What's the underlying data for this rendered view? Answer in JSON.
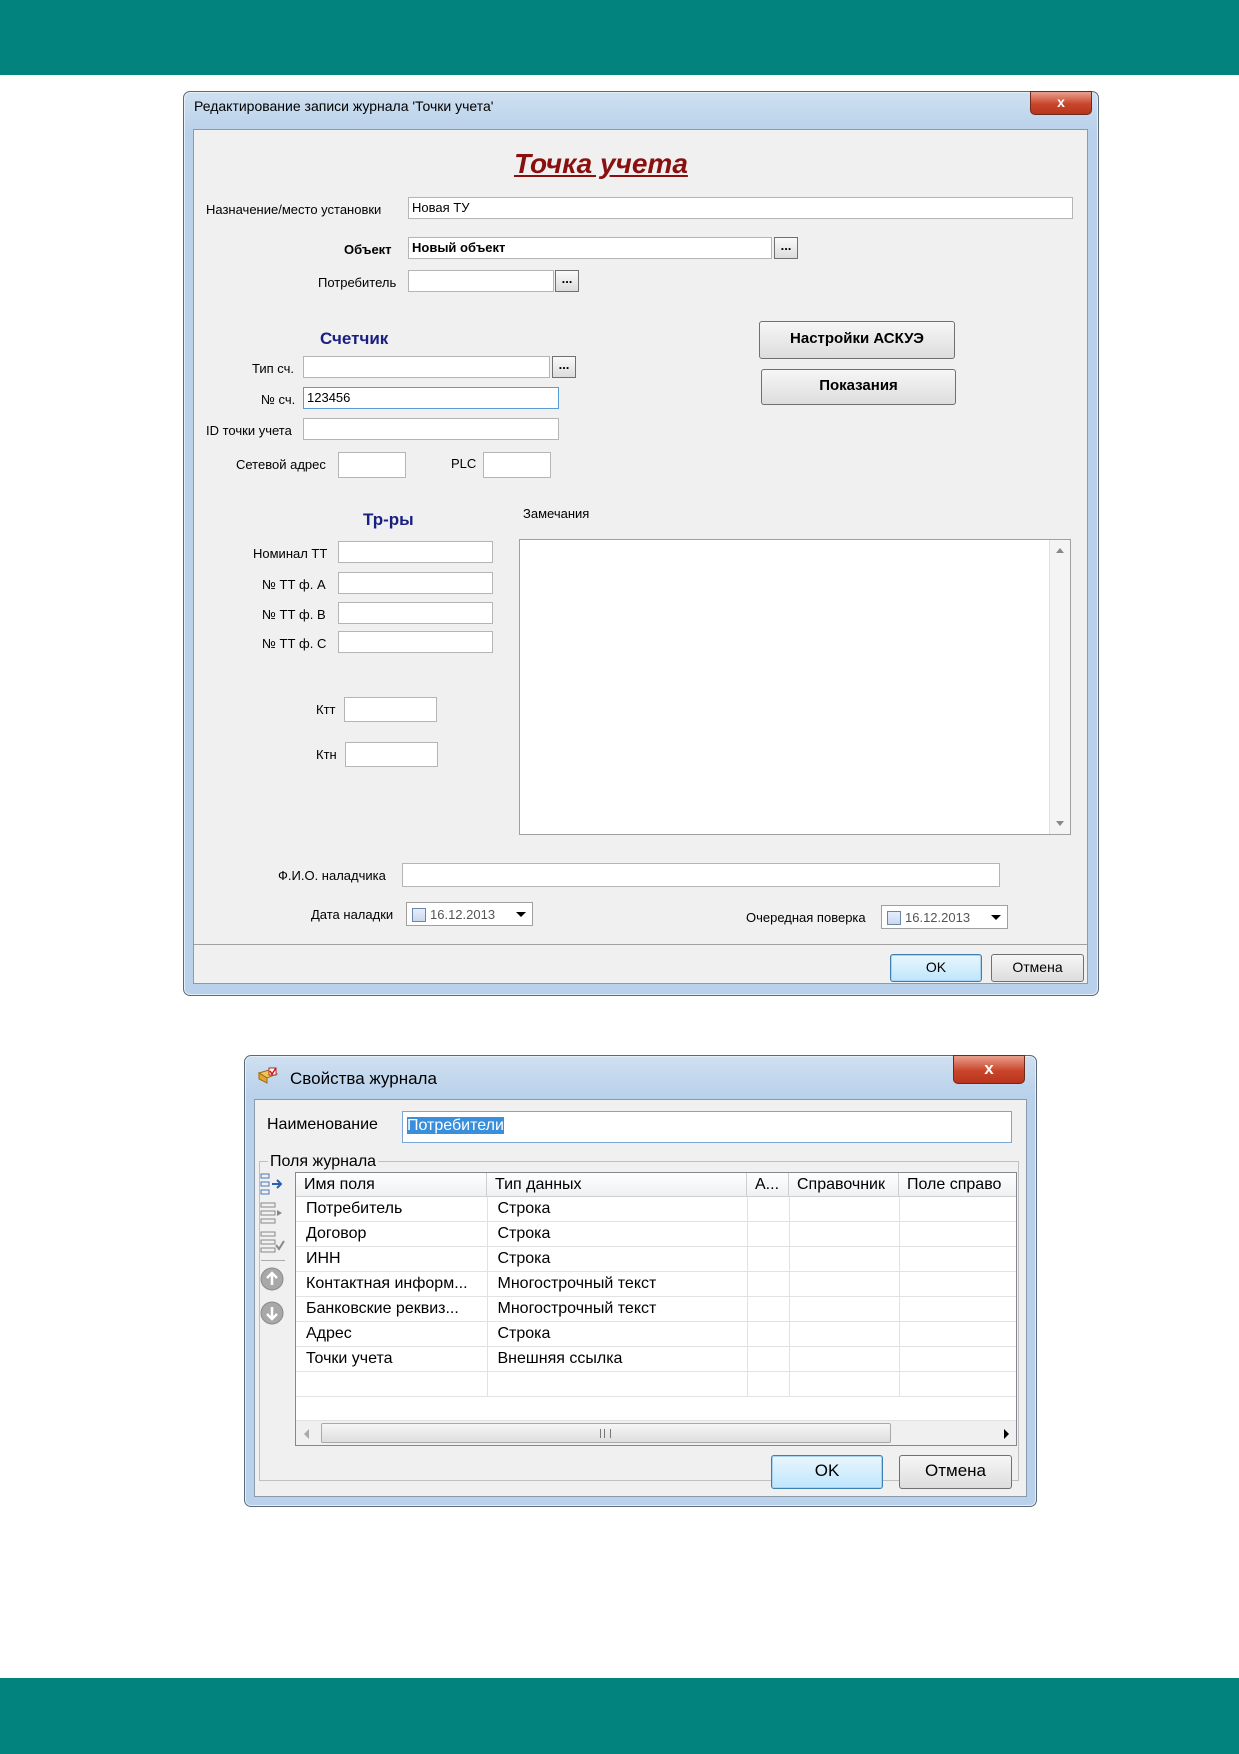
{
  "dialog1": {
    "title": "Редактирование записи журнала 'Точки учета'",
    "close": "x",
    "heading": "Точка учета",
    "purpose_label": "Назначение/место установки",
    "purpose_value": "Новая ТУ",
    "object_label": "Объект",
    "object_value": "Новый объект",
    "consumer_label": "Потребитель",
    "consumer_value": "",
    "meter_section": "Счетчик",
    "meter_type_label": "Тип сч.",
    "meter_type_value": "",
    "meter_no_label": "№ сч.",
    "meter_no_value": "123456",
    "point_id_label": "ID точки учета",
    "point_id_value": "",
    "net_addr_label": "Сетевой адрес",
    "net_addr_value": "",
    "plc_label": "PLC",
    "plc_value": "",
    "askue_button": "Настройки АСКУЭ",
    "readings_button": "Показания",
    "tr_section": "Тр-ры",
    "tt_nominal_label": "Номинал ТТ",
    "tt_a_label": "№ ТТ ф. А",
    "tt_b_label": "№ ТТ ф. В",
    "tt_c_label": "№ ТТ ф. С",
    "ktt_label": "Ктт",
    "ktn_label": "Ктн",
    "remarks_label": "Замечания",
    "adjuster_label": "Ф.И.О. наладчика",
    "adjuster_value": "",
    "adjust_date_label": "Дата наладки",
    "adjust_date_value": "16.12.2013",
    "next_check_label": "Очередная поверка",
    "next_check_value": "16.12.2013",
    "ok": "OK",
    "cancel": "Отмена",
    "dots": "..."
  },
  "dialog2": {
    "title": "Свойства журнала",
    "close": "x",
    "name_label": "Наименование",
    "name_value": "Потребители",
    "fields_group": "Поля журнала",
    "columns": [
      "Имя поля",
      "Тип данных",
      "А...",
      "Справочник",
      "Поле справо"
    ],
    "rows": [
      [
        "Потребитель",
        "Строка"
      ],
      [
        "Договор",
        "Строка"
      ],
      [
        "ИНН",
        "Строка"
      ],
      [
        "Контактная информ...",
        "Многострочный текст"
      ],
      [
        "Банковские реквиз...",
        "Многострочный текст"
      ],
      [
        "Адрес",
        "Строка"
      ],
      [
        "Точки учета",
        "Внешняя ссылка"
      ]
    ],
    "ok": "OK",
    "cancel": "Отмена"
  }
}
